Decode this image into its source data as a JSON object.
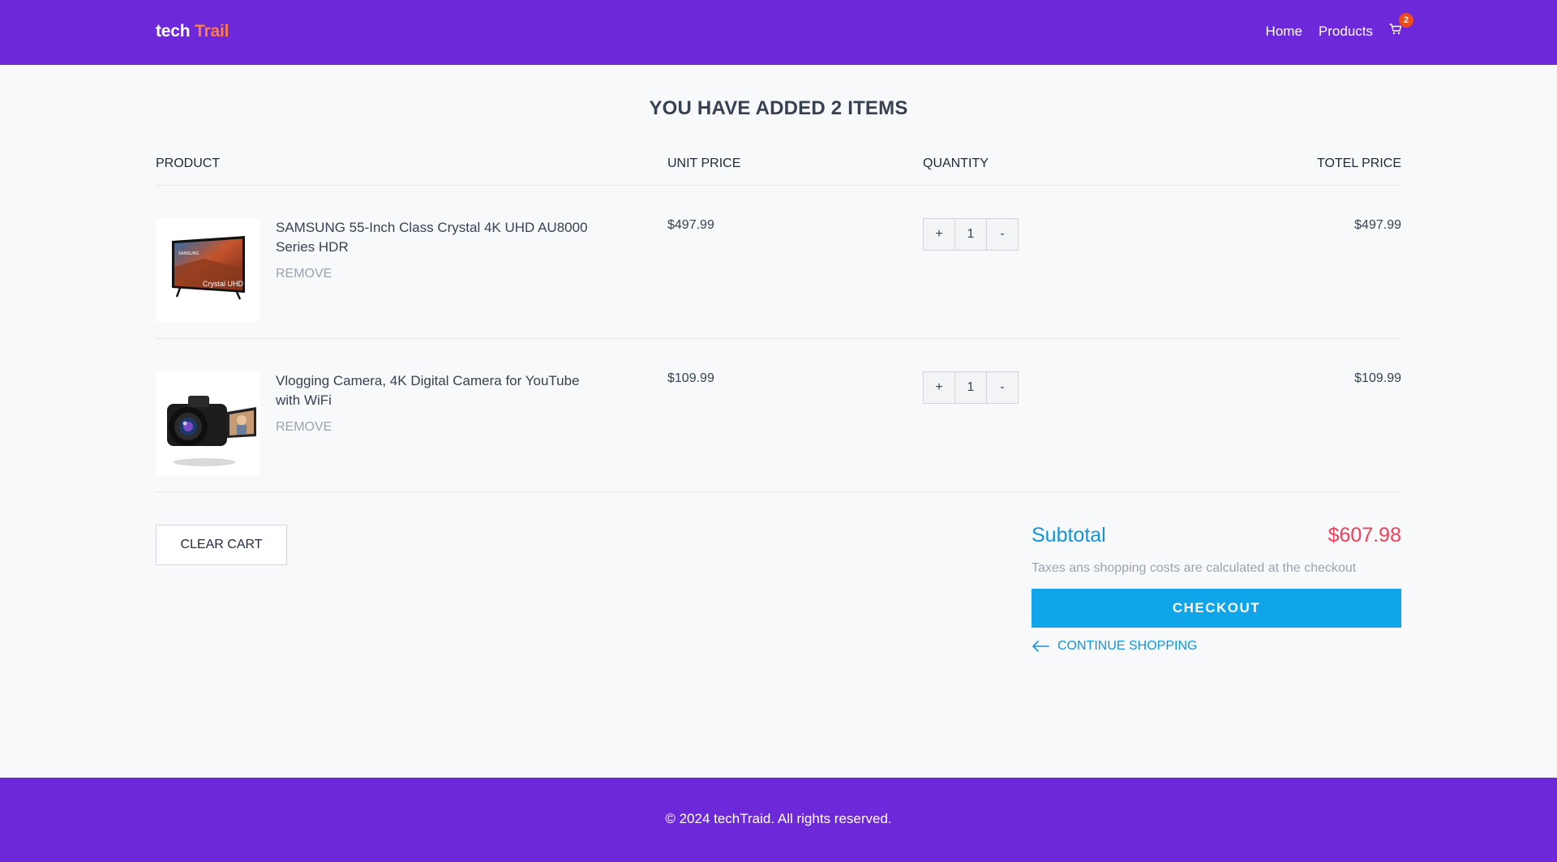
{
  "header": {
    "logo_main": "tech",
    "logo_accent": "Trail",
    "nav": [
      "Home",
      "Products"
    ],
    "cart_count": "2"
  },
  "page_title": "YOU HAVE ADDED 2 ITEMS",
  "table": {
    "columns": [
      "PRODUCT",
      "UNIT PRICE",
      "QUANTITY",
      "TOTEL PRICE"
    ],
    "rows": [
      {
        "name": "SAMSUNG 55-Inch Class Crystal 4K UHD AU8000 Series HDR",
        "remove": "REMOVE",
        "unit_price": "$497.99",
        "qty": "1",
        "total_price": "$497.99",
        "thumb_brand": "SAMSUNG",
        "thumb_caption": "Crystal UHD"
      },
      {
        "name": "Vlogging Camera, 4K Digital Camera for YouTube with WiFi",
        "remove": "REMOVE",
        "unit_price": "$109.99",
        "qty": "1",
        "total_price": "$109.99"
      }
    ],
    "plus": "+",
    "minus": "-"
  },
  "clear_cart": "CLEAR CART",
  "summary": {
    "subtotal_label": "Subtotal",
    "subtotal_value": "$607.98",
    "tax_note": "Taxes ans shopping costs are calculated at the checkout",
    "checkout": "CHECKOUT",
    "continue": "CONTINUE SHOPPING"
  },
  "footer": {
    "copyright": "© 2024 techTraid. All rights reserved."
  },
  "colors": {
    "brand_purple": "#6d28d9",
    "logo_accent": "#fb7a47",
    "link_blue": "#1493d6",
    "checkout_blue": "#10a5e8",
    "price_red": "#ef3f5a"
  },
  "icons": [
    "cart-icon",
    "arrow-left-icon"
  ]
}
